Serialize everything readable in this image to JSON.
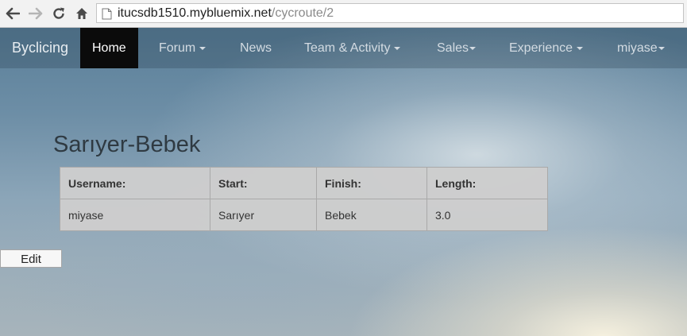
{
  "browser": {
    "url_host": "itucsdb1510.mybluemix.net",
    "url_path": "/cycroute/2",
    "icons": [
      "back-arrow-icon",
      "forward-arrow-icon",
      "reload-icon",
      "home-icon",
      "page-icon"
    ]
  },
  "navbar": {
    "brand": "Byclicing",
    "items": [
      {
        "label": "Home",
        "active": true,
        "dropdown": false
      },
      {
        "label": "Forum",
        "active": false,
        "dropdown": true
      },
      {
        "label": "News",
        "active": false,
        "dropdown": false
      },
      {
        "label": "Team & Activity",
        "active": false,
        "dropdown": true
      },
      {
        "label": "Sales",
        "active": false,
        "dropdown": true
      },
      {
        "label": "Experience",
        "active": false,
        "dropdown": true
      },
      {
        "label": "miyase",
        "active": false,
        "dropdown": true
      }
    ]
  },
  "route": {
    "title": "Sarıyer-Bebek",
    "headers": [
      "Username:",
      "Start:",
      "Finish:",
      "Length:"
    ],
    "rows": [
      [
        "miyase",
        "Sarıyer",
        "Bebek",
        "3.0"
      ]
    ]
  },
  "actions": {
    "edit_label": "Edit"
  },
  "colors": {
    "active_nav_bg": "#0b0b0b",
    "nav_text": "#d3dbe2",
    "title_text": "#2f3a42"
  }
}
